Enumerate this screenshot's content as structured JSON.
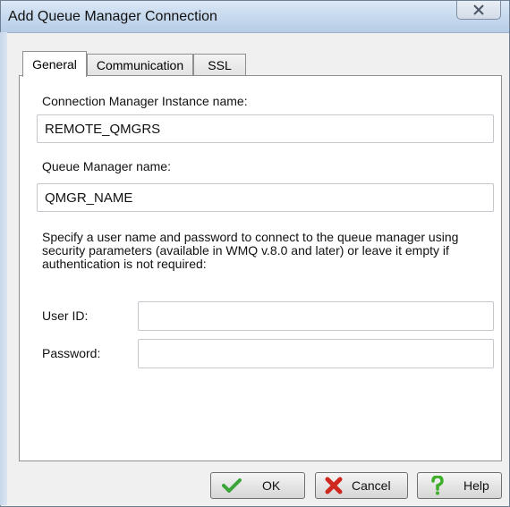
{
  "window": {
    "title": "Add Queue Manager Connection"
  },
  "tabs": [
    {
      "label": "General"
    },
    {
      "label": "Communication"
    },
    {
      "label": "SSL"
    }
  ],
  "form": {
    "instance_label": "Connection Manager Instance name:",
    "instance_value": "REMOTE_QMGRS",
    "qmgr_label": "Queue Manager name:",
    "qmgr_value": "QMGR_NAME",
    "description": "Specify a user name and password to connect to the queue manager using security parameters (available in WMQ v.8.0 and later) or leave it empty if authentication is not required:",
    "userid_label": "User ID:",
    "userid_value": "",
    "password_label": "Password:",
    "password_value": ""
  },
  "buttons": {
    "ok": "OK",
    "cancel": "Cancel",
    "help": "Help"
  },
  "icons": {
    "ok": "checkmark-icon",
    "cancel": "red-x-icon",
    "help": "question-mark-icon",
    "close": "close-icon"
  },
  "colors": {
    "titlebar": "#c9dbef",
    "ok_check": "#3aa63a",
    "cancel_x": "#d0281f",
    "help_q": "#3fae2a"
  }
}
